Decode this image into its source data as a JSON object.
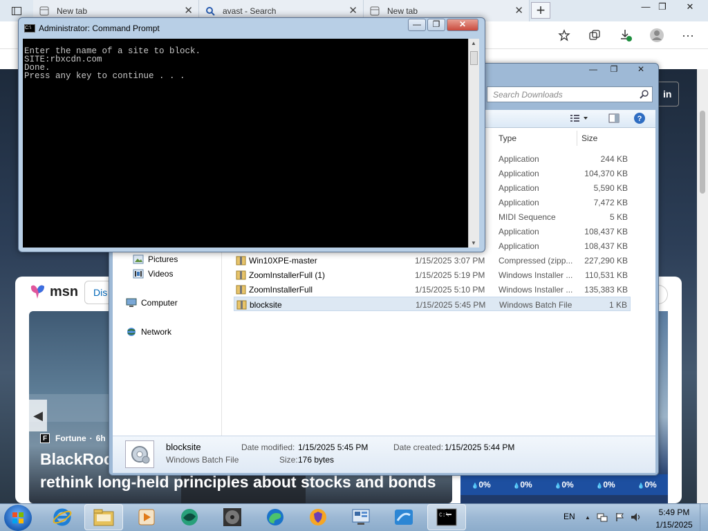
{
  "browser": {
    "tabs": [
      {
        "label": "New tab"
      },
      {
        "label": "avast - Search"
      },
      {
        "label": "New tab"
      }
    ],
    "new_tab_symbol": "+",
    "window_controls": {
      "minimize": "—",
      "restore": "❐",
      "close": "✕"
    },
    "toolbar_icons": [
      "favorites-star-icon",
      "collections-icon",
      "downloads-icon",
      "profile-icon",
      "more-icon"
    ],
    "more_symbol": "···"
  },
  "msn": {
    "logo_text": "msn",
    "discover_text": "Dis",
    "signin_text": "in",
    "hero": {
      "source": "Fortune",
      "source_logo": "F",
      "time": "6h",
      "separator": "·",
      "title_line1": "BlackRoc",
      "title_line2": "rethink long-held principles about stocks and bonds"
    },
    "weather": [
      "0%",
      "0%",
      "0%",
      "0%",
      "0%"
    ],
    "weather_drop": "💧"
  },
  "explorer": {
    "search_placeholder": "Search Downloads",
    "window_controls": {
      "minimize": "—",
      "restore": "❐",
      "close": "✕"
    },
    "columns": {
      "type": "Type",
      "size": "Size"
    },
    "nav": [
      {
        "label": "Pictures"
      },
      {
        "label": "Videos"
      },
      {
        "label": "Computer"
      },
      {
        "label": "Network"
      }
    ],
    "rows": [
      {
        "name": "",
        "date": "",
        "type": "Application",
        "size": "244 KB"
      },
      {
        "name": "",
        "date": "",
        "type": "Application",
        "size": "104,370 KB"
      },
      {
        "name": "",
        "date": "",
        "type": "Application",
        "size": "5,590 KB"
      },
      {
        "name": "",
        "date": "",
        "type": "Application",
        "size": "7,472 KB"
      },
      {
        "name": "",
        "date": "",
        "type": "MIDI Sequence",
        "size": "5 KB"
      },
      {
        "name": "",
        "date": "",
        "type": "Application",
        "size": "108,437 KB"
      },
      {
        "name": "",
        "date": "",
        "type": "Application",
        "size": "108,437 KB"
      },
      {
        "name": "Win10XPE-master",
        "date": "1/15/2025 3:07 PM",
        "type": "Compressed (zipp...",
        "size": "227,290 KB"
      },
      {
        "name": "ZoomInstallerFull (1)",
        "date": "1/15/2025 5:19 PM",
        "type": "Windows Installer ...",
        "size": "110,531 KB"
      },
      {
        "name": "ZoomInstallerFull",
        "date": "1/15/2025 5:10 PM",
        "type": "Windows Installer ...",
        "size": "135,383 KB"
      },
      {
        "name": "blocksite",
        "date": "1/15/2025 5:45 PM",
        "type": "Windows Batch File",
        "size": "1 KB"
      }
    ],
    "details": {
      "name": "blocksite",
      "type": "Windows Batch File",
      "modified_label": "Date modified:",
      "modified_value": "1/15/2025 5:45 PM",
      "created_label": "Date created:",
      "created_value": "1/15/2025 5:44 PM",
      "size_label": "Size:",
      "size_value": "176 bytes"
    }
  },
  "cmd": {
    "title": "Administrator: Command Prompt",
    "icon_text": "C:\\",
    "lines": [
      "Enter the name of a site to block.",
      "SITE:rbxcdn.com",
      "Done.",
      "Press any key to continue . . ."
    ],
    "window_controls": {
      "minimize": "—",
      "restore": "❐",
      "close": "✕"
    }
  },
  "taskbar": {
    "language": "EN",
    "time": "5:49 PM",
    "date": "1/15/2025",
    "tray_arrow": "▲"
  },
  "colors": {
    "cmd_background": "#000000",
    "cmd_text": "#c8c8c8",
    "explorer_frame": "#9eb9d6",
    "taskbar": "#9cb8d4",
    "selection": "#dde8f3",
    "msn_close": "#c94a3d"
  }
}
